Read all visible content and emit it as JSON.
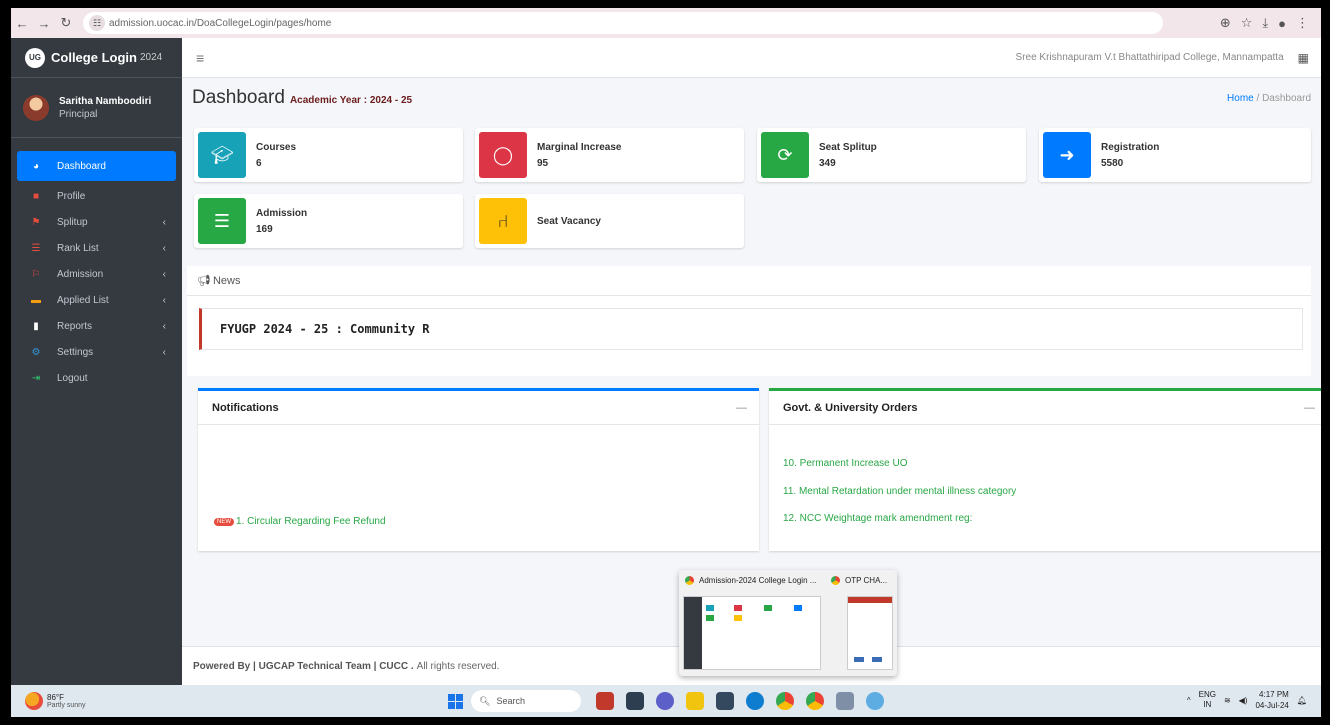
{
  "browser": {
    "url": "admission.uocac.in/DoaCollegeLogin/pages/home"
  },
  "sidebar": {
    "brand_logo": "UG",
    "brand_title": "College Login",
    "brand_year": "2024",
    "user_name": "Saritha Namboodiri",
    "user_role": "Principal",
    "items": [
      {
        "label": "Dashboard",
        "icon": "dashboard-icon",
        "color": "#ffffff"
      },
      {
        "label": "Profile",
        "icon": "profile-icon",
        "color": "#e74c3c"
      },
      {
        "label": "Splitup",
        "icon": "splitup-icon",
        "color": "#e74c3c"
      },
      {
        "label": "Rank List",
        "icon": "list-icon",
        "color": "#e74c3c"
      },
      {
        "label": "Admission",
        "icon": "flag-icon",
        "color": "#e74c3c"
      },
      {
        "label": "Applied List",
        "icon": "folder-icon",
        "color": "#f39c12"
      },
      {
        "label": "Reports",
        "icon": "file-icon",
        "color": "#ffffff"
      },
      {
        "label": "Settings",
        "icon": "gear-icon",
        "color": "#3498db"
      },
      {
        "label": "Logout",
        "icon": "logout-icon",
        "color": "#2ecc71"
      }
    ]
  },
  "topbar": {
    "college_name": "Sree Krishnapuram V.t Bhattathiripad College, Mannampatta"
  },
  "header": {
    "title": "Dashboard",
    "academic_year": "Academic Year : 2024 - 25",
    "breadcrumb_home": "Home",
    "breadcrumb_sep": "/",
    "breadcrumb_current": "Dashboard"
  },
  "boxes": [
    {
      "label": "Courses",
      "value": "6",
      "color": "#17a2b8",
      "icon": "graduation-cap-icon"
    },
    {
      "label": "Marginal Increase",
      "value": "95",
      "color": "#dc3545",
      "icon": "circle-notch-icon"
    },
    {
      "label": "Seat Splitup",
      "value": "349",
      "color": "#28a745",
      "icon": "sync-icon"
    },
    {
      "label": "Registration",
      "value": "5580",
      "color": "#007bff",
      "icon": "sign-in-icon"
    },
    {
      "label": "Admission",
      "value": "169",
      "color": "#28a745",
      "icon": "database-icon"
    },
    {
      "label": "Seat Vacancy",
      "value": "",
      "color": "#ffc107",
      "icon": "chair-icon"
    }
  ],
  "news": {
    "heading": "News",
    "ticker": "FYUGP 2024 - 25 : Community R"
  },
  "notifications": {
    "title": "Notifications",
    "new_badge": "NEW",
    "items": [
      "1. Circular Regarding Fee Refund"
    ]
  },
  "orders": {
    "title": "Govt. & University Orders",
    "items": [
      "10. Permanent Increase UO",
      "11. Mental Retardation under mental illness category",
      "12. NCC Weightage mark amendment reg:"
    ]
  },
  "footer": {
    "prefix": "Powered By | UGCAP Technical Team | CUCC .",
    "suffix": "All rights reserved."
  },
  "preview": {
    "tab1": "Admission-2024 College Login ...",
    "tab2": "OTP CHA..."
  },
  "taskbar": {
    "weather_temp": "86°F",
    "weather_desc": "Partly sunny",
    "search_placeholder": "Search",
    "lang": "ENG",
    "region": "IN",
    "time": "4:17 PM",
    "date": "04-Jul-24"
  }
}
